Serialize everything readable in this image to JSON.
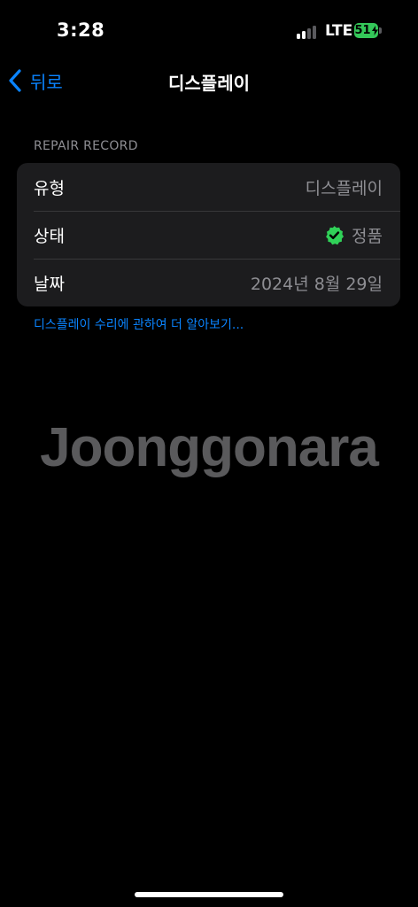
{
  "status_bar": {
    "time": "3:28",
    "network": "LTE",
    "battery": "51"
  },
  "nav": {
    "back_label": "뒤로",
    "title": "디스플레이"
  },
  "section": {
    "header": "REPAIR RECORD",
    "rows": [
      {
        "label": "유형",
        "value": "디스플레이"
      },
      {
        "label": "상태",
        "value": "정품",
        "icon": "check-badge-icon"
      },
      {
        "label": "날짜",
        "value": "2024년 8월 29일"
      }
    ],
    "footer_link": "디스플레이 수리에 관하여 더 알아보기..."
  },
  "watermark": "Joonggonara",
  "colors": {
    "background": "#000000",
    "group_background": "#1c1c1e",
    "accent": "#0a84ff",
    "secondary_text": "#8e8e93",
    "badge_green": "#30d158",
    "battery_green": "#34c759"
  }
}
